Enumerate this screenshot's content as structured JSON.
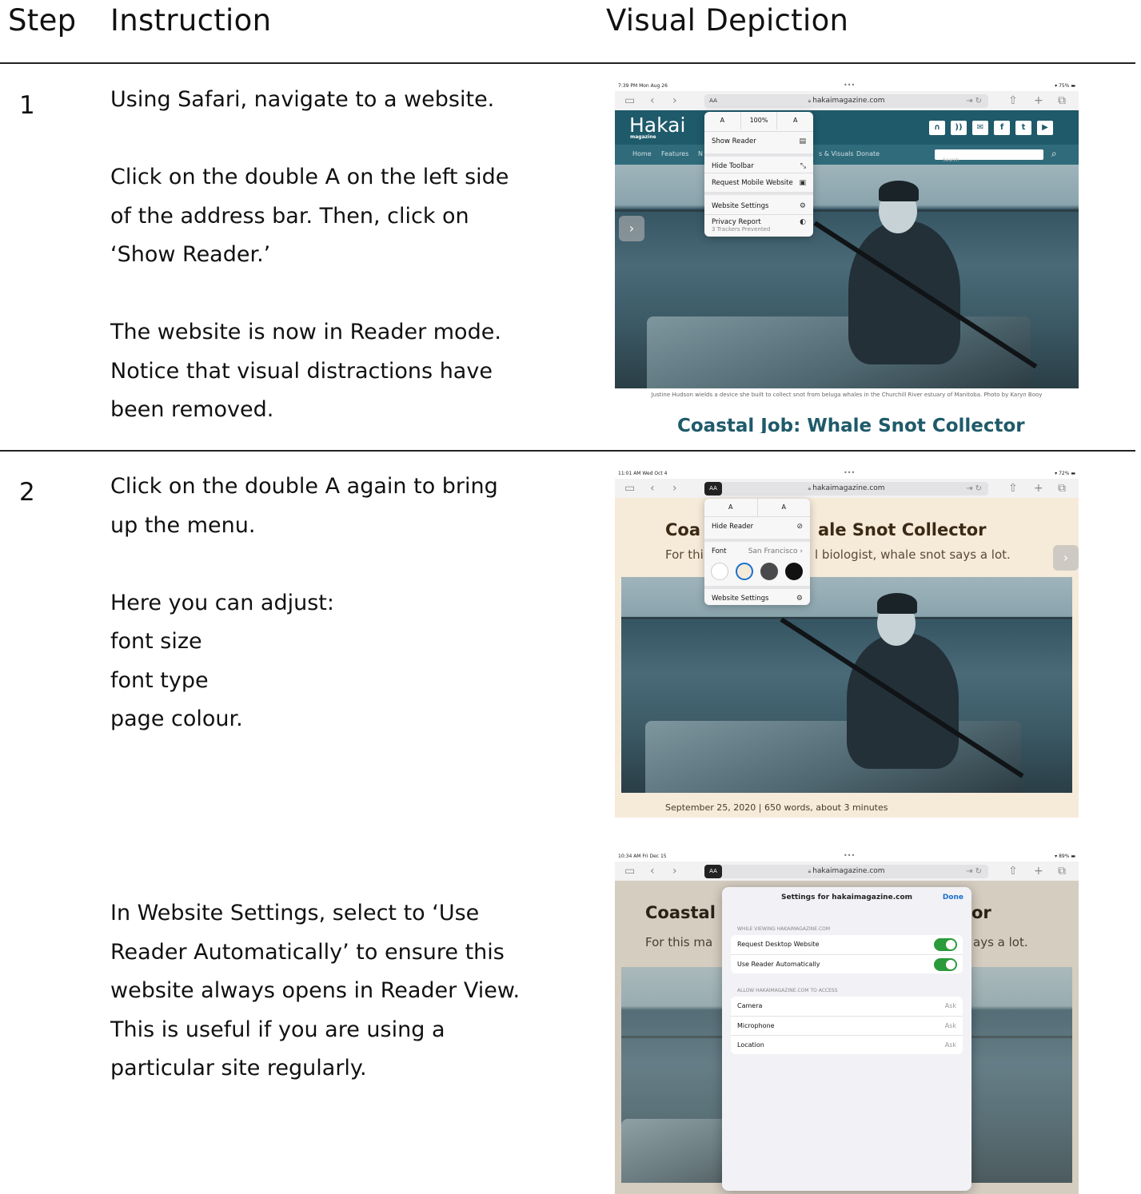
{
  "headers": {
    "step": "Step",
    "instruction": "Instruction",
    "visual": "Visual Depiction"
  },
  "steps": [
    {
      "number": "1",
      "instruction": "Using Safari, navigate to a website.\n\nClick on the double A on the left side\nof the address bar.  Then, click on\n‘Show Reader.’\n\nThe website is now in Reader mode.\nNotice that visual distractions have\nbeen removed."
    },
    {
      "number": "2",
      "instruction": "Click on the double A again to bring\nup the menu.\n\nHere you can adjust:\nfont size\nfont type\npage colour."
    },
    {
      "number": "",
      "instruction": "In Website Settings, select to ‘Use\nReader Automatically’ to ensure this\nwebsite always opens in Reader View.\nThis is useful if you are using a\nparticular site regularly."
    }
  ],
  "browser": {
    "url": "hakaimagazine.com",
    "aa_label": "AA",
    "status_times": [
      "7:39 PM  Mon Aug 26",
      "11:01 AM  Wed Oct 4",
      "10:34 AM  Fri Dec 15"
    ],
    "battery": [
      "75%",
      "72%",
      "89%"
    ]
  },
  "shot1": {
    "logo": "Hakai",
    "logo_sub": "magazine",
    "nav": [
      "Home",
      "Features",
      "N",
      "s & Visuals",
      "Donate"
    ],
    "search_placeholder": "Search",
    "menu": {
      "size_small": "A",
      "zoom": "100%",
      "size_large": "A",
      "items": [
        {
          "label": "Show Reader"
        },
        {
          "label": "Hide Toolbar"
        },
        {
          "label": "Request Mobile Website"
        },
        {
          "label": "Website Settings"
        },
        {
          "label": "Privacy Report",
          "sub": "3 Trackers Prevented"
        }
      ]
    },
    "caption": "Justine Hudson wields a device she built to collect snot from beluga whales in the Churchill River estuary of Manitoba. Photo by Karyn Booy",
    "title_cut": "Coastal Job: Whale Snot Collector"
  },
  "shot2": {
    "title_left": "Coa",
    "title_right": "ale Snot Collector",
    "sub_left": "For thi",
    "sub_right": "l biologist, whale snot says a lot.",
    "meta": "September 25, 2020 | 650 words, about 3 minutes",
    "menu": {
      "size_small": "A",
      "size_large": "A",
      "hide_reader": "Hide Reader",
      "font_label": "Font",
      "font_value": "San Francisco",
      "website_settings": "Website Settings"
    },
    "swatch_colors": [
      "#ffffff",
      "#f4ead8",
      "#4a4a4c",
      "#111111"
    ]
  },
  "shot3": {
    "title_left": "Coastal",
    "title_right": "or",
    "sub_left": "For this ma",
    "sub_right": "ays a lot.",
    "sheet_title": "Settings for hakaimagazine.com",
    "done": "Done",
    "section1": "WHILE VIEWING HAKAIMAGAZINE.COM",
    "toggles": [
      "Request Desktop Website",
      "Use Reader Automatically"
    ],
    "section2": "ALLOW HAKAIMAGAZINE.COM TO ACCESS",
    "permissions": [
      {
        "label": "Camera",
        "value": "Ask"
      },
      {
        "label": "Microphone",
        "value": "Ask"
      },
      {
        "label": "Location",
        "value": "Ask"
      }
    ]
  },
  "colors": {
    "hakai_teal": "#1e5a6a",
    "reader_sepia": "#f6ead9",
    "toggle_on": "#2b9a3a",
    "link_blue": "#1a6fd0"
  }
}
